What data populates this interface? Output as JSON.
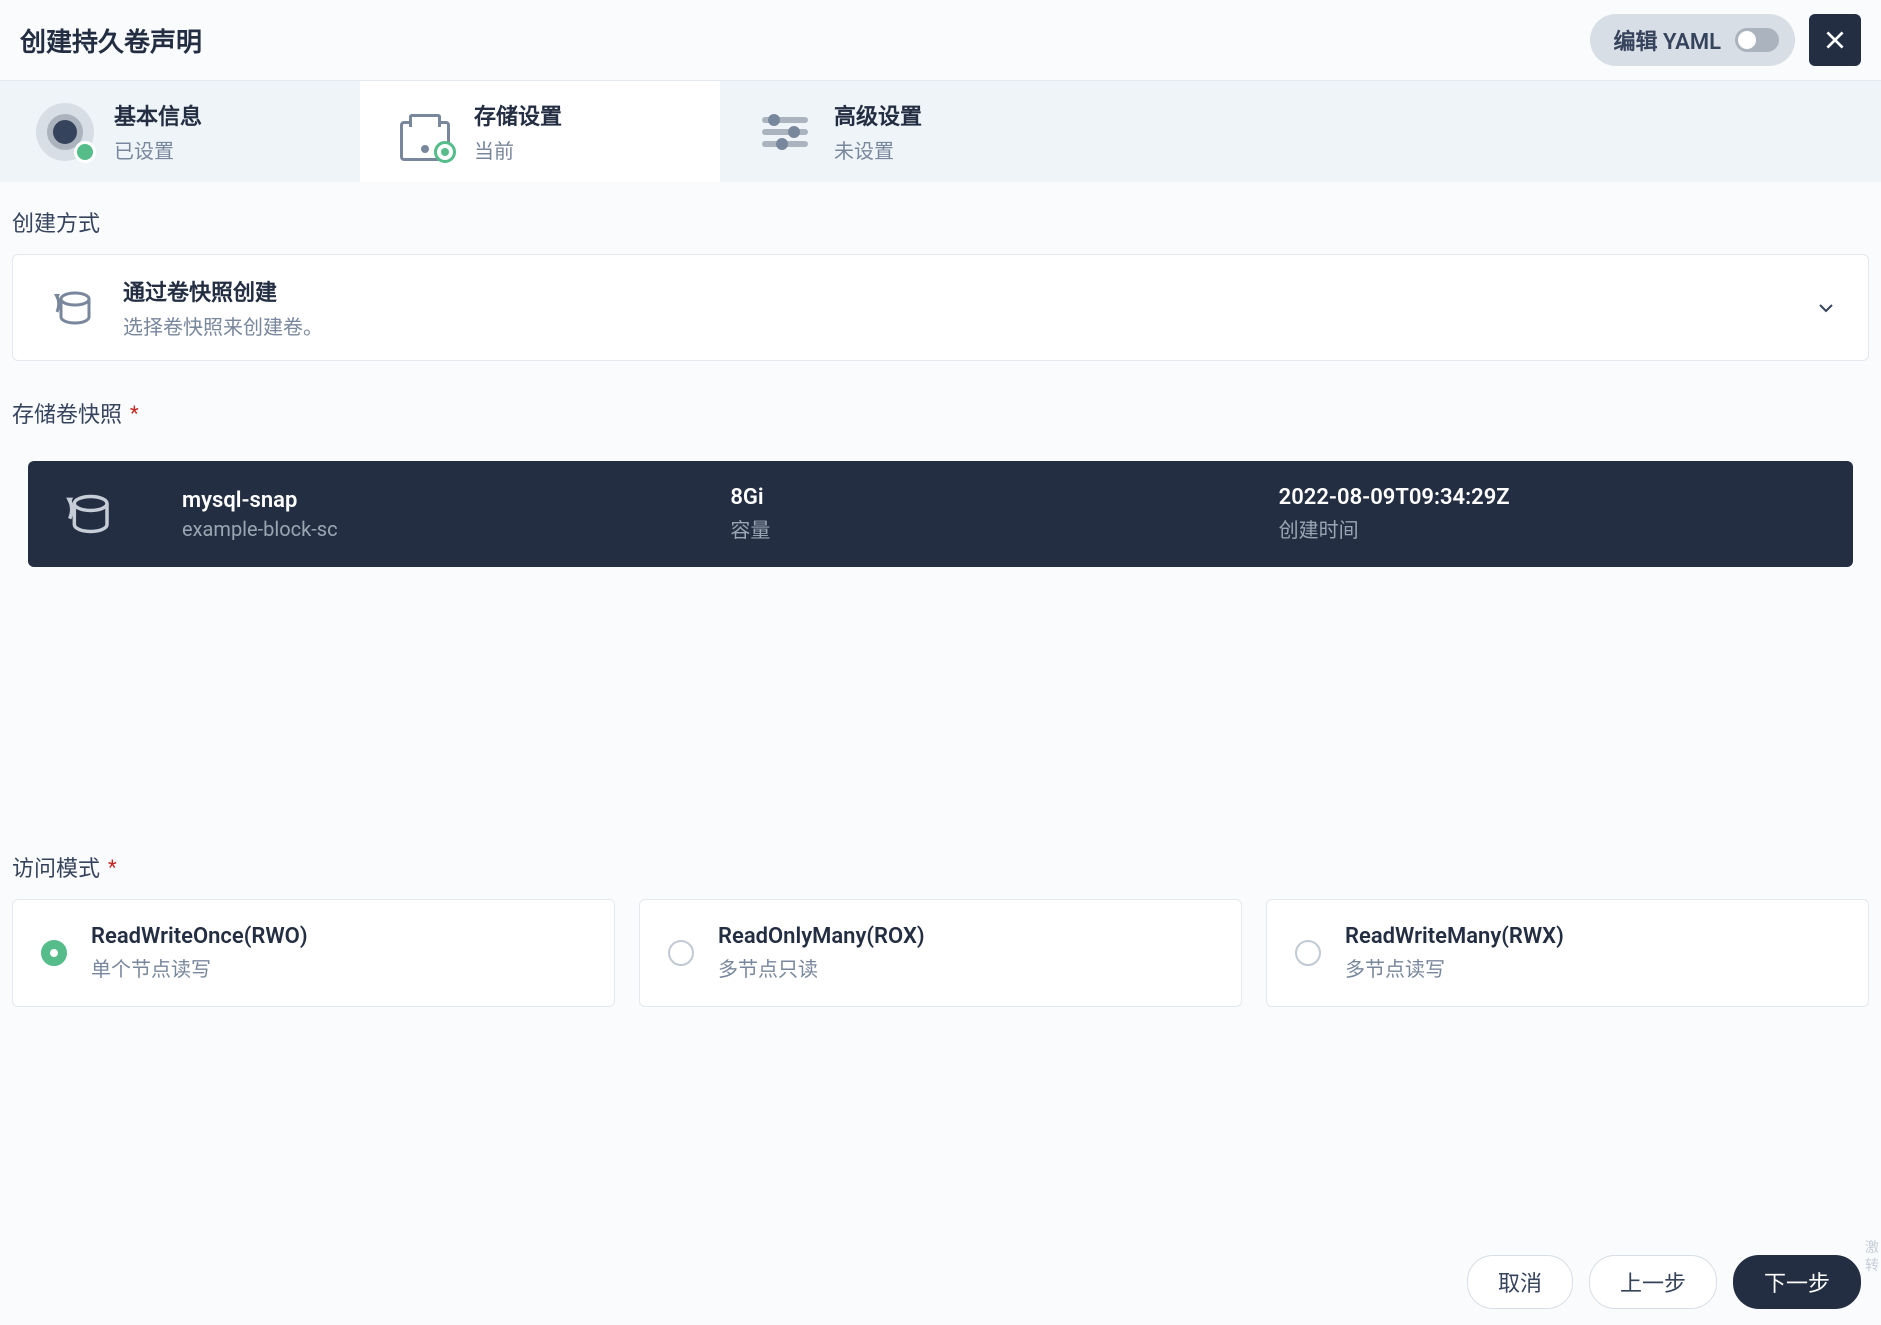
{
  "header": {
    "title": "创建持久卷声明",
    "yaml_label": "编辑 YAML"
  },
  "stepper": {
    "items": [
      {
        "title": "基本信息",
        "sub": "已设置",
        "status": "done"
      },
      {
        "title": "存储设置",
        "sub": "当前",
        "status": "current"
      },
      {
        "title": "高级设置",
        "sub": "未设置",
        "status": "pending"
      }
    ]
  },
  "creation_method": {
    "section_label": "创建方式",
    "title": "通过卷快照创建",
    "description": "选择卷快照来创建卷。"
  },
  "snapshot": {
    "section_label": "存储卷快照",
    "name": "mysql-snap",
    "storage_class": "example-block-sc",
    "capacity_value": "8Gi",
    "capacity_label": "容量",
    "created_value": "2022-08-09T09:34:29Z",
    "created_label": "创建时间"
  },
  "access": {
    "section_label": "访问模式",
    "modes": [
      {
        "title": "ReadWriteOnce(RWO)",
        "desc": "单个节点读写",
        "selected": true
      },
      {
        "title": "ReadOnlyMany(ROX)",
        "desc": "多节点只读",
        "selected": false
      },
      {
        "title": "ReadWriteMany(RWX)",
        "desc": "多节点读写",
        "selected": false
      }
    ]
  },
  "footer": {
    "cancel": "取消",
    "prev": "上一步",
    "next": "下一步"
  },
  "watermark": {
    "l1": "激",
    "l2": "转"
  }
}
